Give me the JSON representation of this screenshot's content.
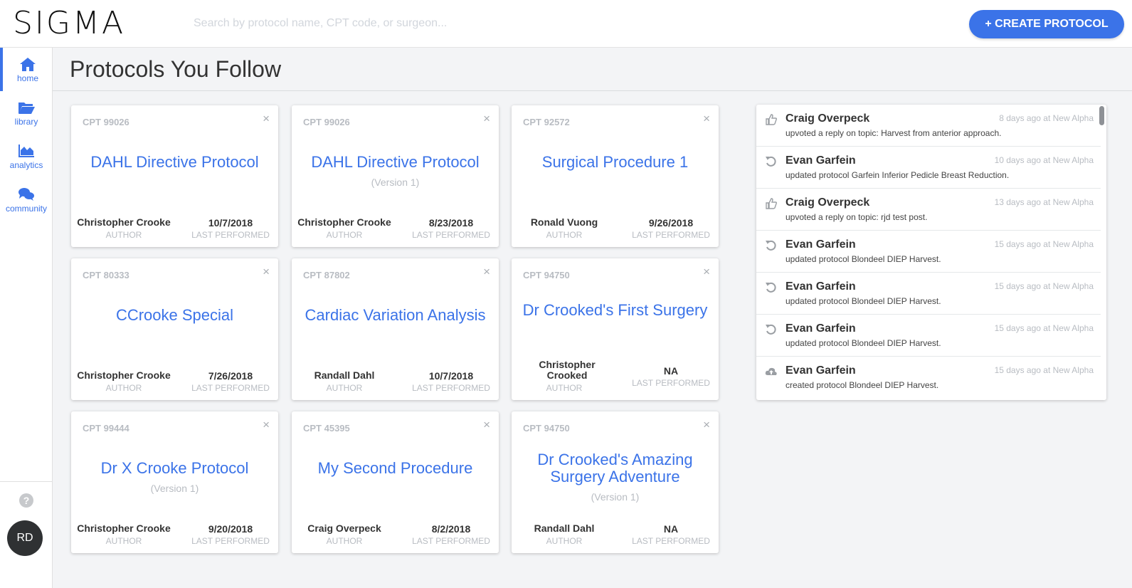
{
  "header": {
    "logo": "SIGMA",
    "search_placeholder": "Search by protocol name, CPT code, or surgeon...",
    "create_button": "+ CREATE PROTOCOL"
  },
  "sidebar": {
    "items": [
      {
        "label": "home",
        "icon": "home-icon"
      },
      {
        "label": "library",
        "icon": "folder-icon"
      },
      {
        "label": "analytics",
        "icon": "area-chart-icon"
      },
      {
        "label": "community",
        "icon": "comments-icon"
      }
    ],
    "help": "?",
    "avatar": "RD"
  },
  "page": {
    "title": "Protocols You Follow"
  },
  "cards": [
    {
      "cpt": "CPT 99026",
      "title": "DAHL Directive Protocol",
      "version": "",
      "author": "Christopher Crooke",
      "author_label": "AUTHOR",
      "date": "10/7/2018",
      "date_label": "LAST PERFORMED",
      "close": "×"
    },
    {
      "cpt": "CPT 99026",
      "title": "DAHL Directive Protocol",
      "version": "(Version 1)",
      "author": "Christopher Crooke",
      "author_label": "AUTHOR",
      "date": "8/23/2018",
      "date_label": "LAST PERFORMED",
      "close": "×"
    },
    {
      "cpt": "CPT 92572",
      "title": "Surgical Procedure 1",
      "version": "",
      "author": "Ronald Vuong",
      "author_label": "AUTHOR",
      "date": "9/26/2018",
      "date_label": "LAST PERFORMED",
      "close": "×"
    },
    {
      "cpt": "CPT 80333",
      "title": "CCrooke Special",
      "version": "",
      "author": "Christopher Crooke",
      "author_label": "AUTHOR",
      "date": "7/26/2018",
      "date_label": "LAST PERFORMED",
      "close": "×"
    },
    {
      "cpt": "CPT 87802",
      "title": "Cardiac Variation Analysis",
      "version": "",
      "author": "Randall Dahl",
      "author_label": "AUTHOR",
      "date": "10/7/2018",
      "date_label": "LAST PERFORMED",
      "close": "×"
    },
    {
      "cpt": "CPT 94750",
      "title": "Dr Crooked's First Surgery",
      "version": "",
      "author": "Christopher Crooked",
      "author_label": "AUTHOR",
      "date": "NA",
      "date_label": "LAST PERFORMED",
      "close": "×"
    },
    {
      "cpt": "CPT 99444",
      "title": "Dr X Crooke Protocol",
      "version": "(Version 1)",
      "author": "Christopher Crooke",
      "author_label": "AUTHOR",
      "date": "9/20/2018",
      "date_label": "LAST PERFORMED",
      "close": "×"
    },
    {
      "cpt": "CPT 45395",
      "title": "My Second Procedure",
      "version": "",
      "author": "Craig Overpeck",
      "author_label": "AUTHOR",
      "date": "8/2/2018",
      "date_label": "LAST PERFORMED",
      "close": "×"
    },
    {
      "cpt": "CPT 94750",
      "title": "Dr Crooked's Amazing Surgery Adventure",
      "version": "(Version 1)",
      "author": "Randall Dahl",
      "author_label": "AUTHOR",
      "date": "NA",
      "date_label": "LAST PERFORMED",
      "close": "×"
    }
  ],
  "feed": [
    {
      "icon": "thumbs-up-icon",
      "name": "Craig Overpeck",
      "desc": "upvoted a reply on topic: Harvest from anterior approach.",
      "time": "8 days ago at New Alpha"
    },
    {
      "icon": "history-icon",
      "name": "Evan Garfein",
      "desc": "updated protocol Garfein Inferior Pedicle Breast Reduction.",
      "time": "10 days ago at New Alpha"
    },
    {
      "icon": "thumbs-up-icon",
      "name": "Craig Overpeck",
      "desc": "upvoted a reply on topic: rjd test post.",
      "time": "13 days ago at New Alpha"
    },
    {
      "icon": "history-icon",
      "name": "Evan Garfein",
      "desc": "updated protocol Blondeel DIEP Harvest.",
      "time": "15 days ago at New Alpha"
    },
    {
      "icon": "history-icon",
      "name": "Evan Garfein",
      "desc": "updated protocol Blondeel DIEP Harvest.",
      "time": "15 days ago at New Alpha"
    },
    {
      "icon": "history-icon",
      "name": "Evan Garfein",
      "desc": "updated protocol Blondeel DIEP Harvest.",
      "time": "15 days ago at New Alpha"
    },
    {
      "icon": "cloud-upload-icon",
      "name": "Evan Garfein",
      "desc": "created protocol Blondeel DIEP Harvest.",
      "time": "15 days ago at New Alpha"
    }
  ],
  "colors": {
    "accent": "#3b73e8",
    "muted": "#b8bcc2",
    "background": "#f3f4f6"
  }
}
